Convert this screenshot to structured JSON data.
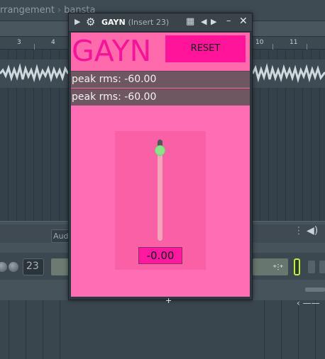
{
  "daw": {
    "breadcrumb": [
      "rrangement",
      "bansta"
    ],
    "bar_numbers": [
      "3",
      "4",
      "10",
      "11"
    ],
    "mixer": {
      "audio_label": "Aud",
      "insert_number": "23"
    }
  },
  "plugin_window": {
    "title": "GAYN",
    "subtitle": "(Insert 23)",
    "icons": {
      "collapse": "triangle-right-icon",
      "settings": "gear-icon",
      "grid": "grid-icon",
      "prev": "arrow-left-icon",
      "next": "arrow-right-icon",
      "minimize": "minimize-icon",
      "close": "close-icon"
    },
    "plugin": {
      "logo": "GAYN",
      "reset_label": "RESET",
      "meters": [
        "peak rms: -60.00",
        "peak rms: -60.00"
      ],
      "gain_value": "-0.00",
      "gain_level": 0.0
    }
  },
  "colors": {
    "plugin_bg": "#ff6eb4",
    "logo": "#f5139a",
    "reset_bg": "#ff149a",
    "meter_bg": "#6f5761",
    "knob": "#8fe08b",
    "led": "#bff04a"
  }
}
